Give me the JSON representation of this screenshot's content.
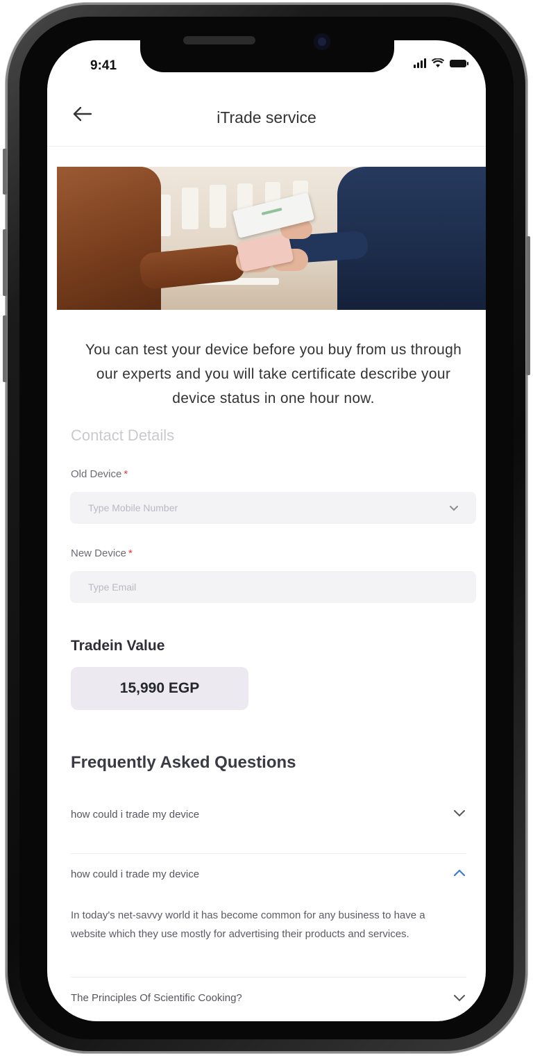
{
  "status_bar": {
    "time": "9:41"
  },
  "nav": {
    "title": "iTrade service"
  },
  "intro_text": "You can test your device before you buy from us through our experts and you will take certificate describe your device status in one hour now.",
  "contact": {
    "section_title": "Contact Details",
    "old_device": {
      "label": "Old Device",
      "required_mark": "*",
      "placeholder": "Type Mobile Number"
    },
    "new_device": {
      "label": "New Device",
      "required_mark": "*",
      "placeholder": "Type Email"
    }
  },
  "tradein": {
    "title": "Tradein Value",
    "value": "15,990 EGP"
  },
  "faq": {
    "title": "Frequently Asked Questions",
    "items": [
      {
        "question": "how could i trade my device",
        "expanded": false
      },
      {
        "question": "how could i trade my device",
        "expanded": true,
        "answer": "In today's net-savvy world it has become common for any business to have a website which they use mostly for advertising their products and services."
      },
      {
        "question": "The Principles Of Scientific Cooking?",
        "expanded": false
      }
    ]
  },
  "colors": {
    "accent": "#3a7bd5",
    "required": "#e53935",
    "input_bg": "#f3f3f6",
    "tradein_bg": "#eceaf0"
  }
}
